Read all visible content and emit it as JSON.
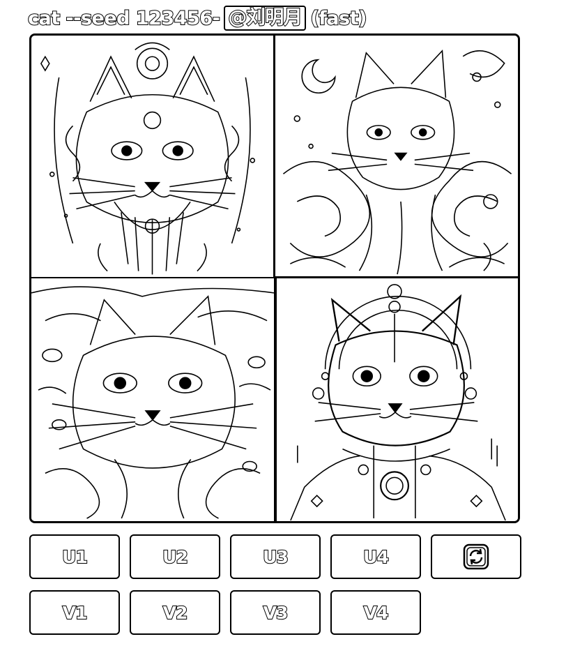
{
  "message": {
    "prompt": "cat --seed 123456",
    "separator": " - ",
    "mention": "@刘明月",
    "speed": "(fast)"
  },
  "grid": {
    "images": [
      {
        "index": 1,
        "subject": "ornate symmetrical cat face with crescent/orb crown, line art"
      },
      {
        "index": 2,
        "subject": "long-haired cat with swirling waves and crescent moon, line art"
      },
      {
        "index": 3,
        "subject": "cat face in tangled foliage, line art"
      },
      {
        "index": 4,
        "subject": "cat with celestial orbs and jeweled collar, line art"
      }
    ]
  },
  "buttons": {
    "upscale": [
      "U1",
      "U2",
      "U3",
      "U4"
    ],
    "variation": [
      "V1",
      "V2",
      "V3",
      "V4"
    ],
    "reroll_icon": "reroll-icon"
  }
}
